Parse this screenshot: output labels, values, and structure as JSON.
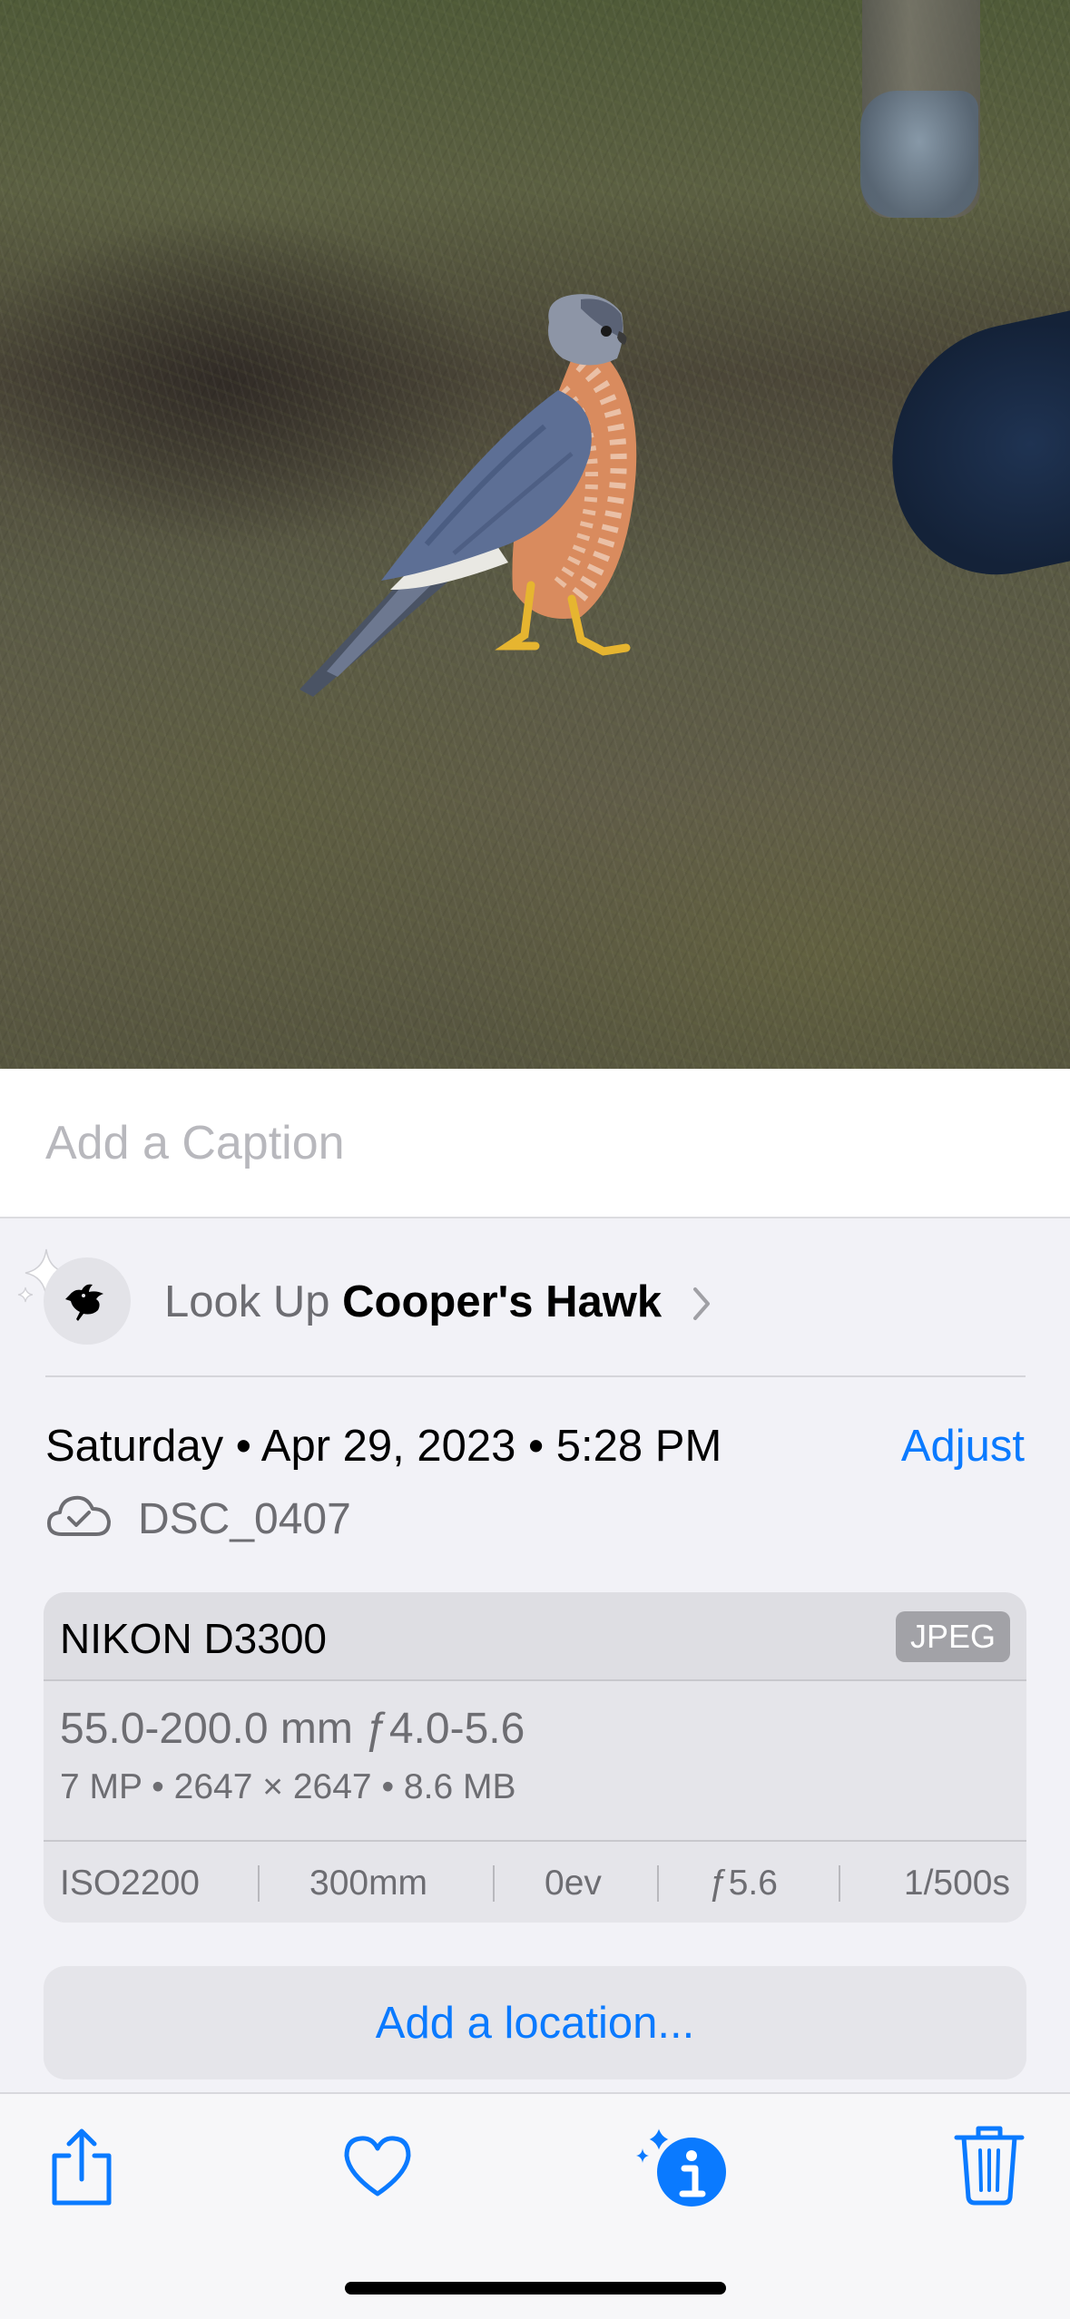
{
  "photo": {
    "subject_icon": "hawk-photo"
  },
  "caption": {
    "placeholder": "Add a Caption",
    "value": ""
  },
  "lookup": {
    "prefix": "Look Up",
    "subject": "Cooper's Hawk",
    "icon": "bird-icon"
  },
  "info": {
    "date": "Saturday • Apr 29, 2023 • 5:28 PM",
    "adjust_label": "Adjust",
    "filename": "DSC_0407",
    "sync_icon": "icloud-check-icon"
  },
  "camera": {
    "model": "NIKON D3300",
    "format": "JPEG",
    "lens": "55.0-200.0 mm ƒ4.0-5.6",
    "specs": "7 MP  •  2647 × 2647  •  8.6 MB",
    "exif": {
      "iso": "ISO2200",
      "focal": "300mm",
      "ev": "0ev",
      "aperture": "ƒ5.6",
      "shutter": "1/500s"
    }
  },
  "location": {
    "label": "Add a location..."
  },
  "toolbar": {
    "items": [
      "share-icon",
      "heart-icon",
      "info-sparkle-icon",
      "trash-icon"
    ],
    "accent": "#0a7aff"
  }
}
